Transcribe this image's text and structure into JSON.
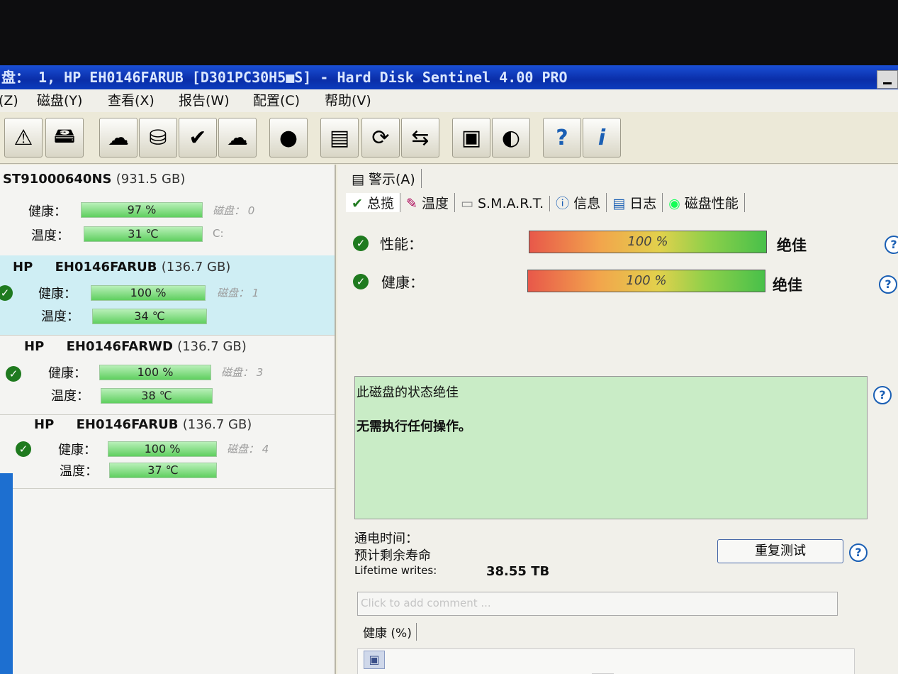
{
  "window": {
    "title": "盘： 1, HP    EH0146FARUB [D301PC30H5■S]  -  Hard Disk Sentinel 4.00 PRO"
  },
  "menu": [
    "(Z)",
    "磁盘(Y)",
    "查看(X)",
    "报告(W)",
    "配置(C)",
    "帮助(V)"
  ],
  "toolbar": {
    "icons": [
      "warning-icon",
      "disk-icon",
      "drive-cloud-icon",
      "drive-info-icon",
      "drive-check-icon",
      "drive-cloud-2-icon",
      "blob-icon",
      "document-icon",
      "refresh-icon",
      "network-icon",
      "terminal-icon",
      "speaker-icon",
      "help-icon",
      "info-icon"
    ],
    "help_glyph": "?",
    "info_glyph": "i"
  },
  "disks": [
    {
      "brand": "",
      "model": "ST91000640NS",
      "capacity": "(931.5 GB)",
      "health_label": "健康：",
      "health": "97 %",
      "temp_label": "温度：",
      "temp": "31 ℃",
      "disk_label": "磁盘：",
      "disk_no": "0",
      "volume": "C:"
    },
    {
      "brand": "HP",
      "model": "EH0146FARUB",
      "capacity": "(136.7 GB)",
      "health_label": "健康：",
      "health": "100 %",
      "temp_label": "温度：",
      "temp": "34 ℃",
      "disk_label": "磁盘：",
      "disk_no": "1"
    },
    {
      "brand": "HP",
      "model": "EH0146FARWD",
      "capacity": "(136.7 GB)",
      "health_label": "健康：",
      "health": "100 %",
      "temp_label": "温度：",
      "temp": "38 ℃",
      "disk_label": "磁盘：",
      "disk_no": "3"
    },
    {
      "brand": "HP",
      "model": "EH0146FARUB",
      "capacity": "(136.7 GB)",
      "health_label": "健康：",
      "health": "100 %",
      "temp_label": "温度：",
      "temp": "37 ℃",
      "disk_label": "磁盘：",
      "disk_no": "4"
    }
  ],
  "tabs": {
    "alerts": "警示(A)",
    "row2": [
      "总揽",
      "温度",
      "S.M.A.R.T.",
      "信息",
      "日志",
      "磁盘性能"
    ]
  },
  "overview": {
    "performance_label": "性能：",
    "performance_value": "100 %",
    "performance_level": 1.0,
    "performance_rating": "绝佳",
    "health_label": "健康：",
    "health_value": "100 %",
    "health_level": 1.0,
    "health_rating": "绝佳",
    "status_line1": "此磁盘的状态绝佳",
    "status_line2": "无需执行任何操作。",
    "power_on_label": "通电时间：",
    "remaining_label": "预计剩余寿命",
    "lifetime_label": "Lifetime writes:",
    "lifetime_value": "38.55 TB",
    "retest_button": "重复测试",
    "comment_placeholder": "Click to add comment ...",
    "chart_tab": "健康 (%)",
    "chart_max": "100"
  },
  "colors": {
    "title_bar": "#0a2ea8",
    "selected_disk": "#cfeef4",
    "status_box": "#c9ecc6",
    "health_bar": "#5fcf5f"
  }
}
